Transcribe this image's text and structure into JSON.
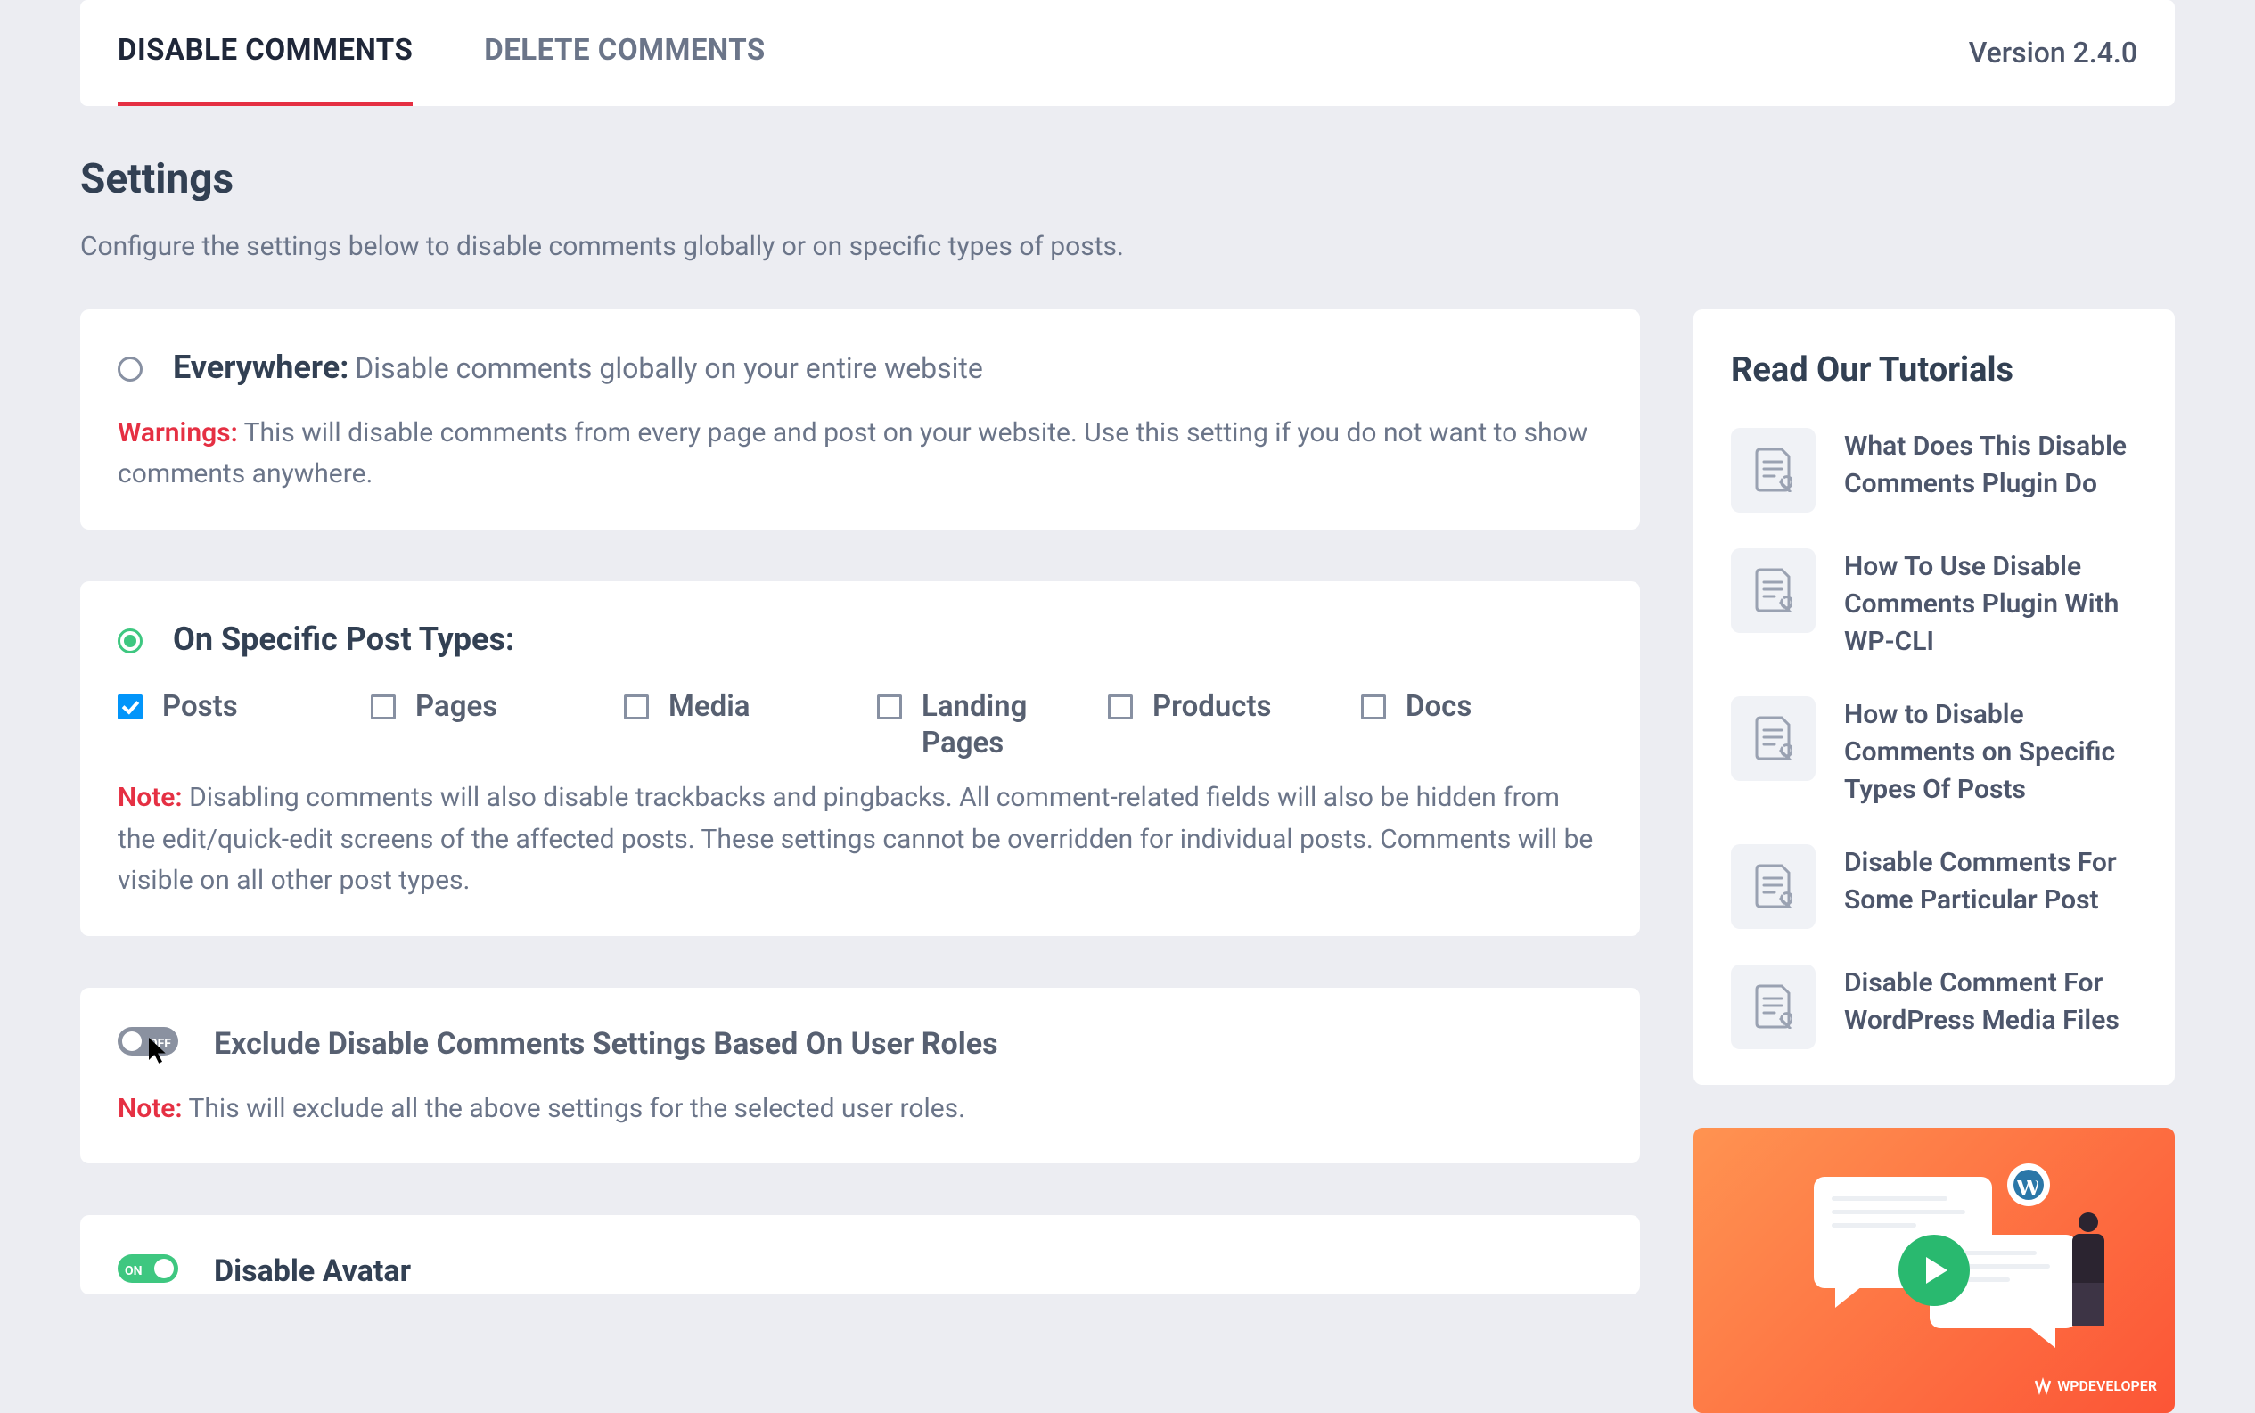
{
  "tabs": {
    "disable": "DISABLE COMMENTS",
    "delete": "DELETE COMMENTS"
  },
  "version": "Version 2.4.0",
  "page": {
    "title": "Settings",
    "subtitle": "Configure the settings below to disable comments globally or on specific types of posts."
  },
  "everywhere": {
    "title": "Everywhere:",
    "desc": "Disable comments globally on your entire website",
    "warn_label": "Warnings:",
    "warn_text": "This will disable comments from every page and post on your website. Use this setting if you do not want to show comments anywhere."
  },
  "specific": {
    "title": "On Specific Post Types:",
    "types": [
      {
        "label": "Posts",
        "checked": true
      },
      {
        "label": "Pages",
        "checked": false
      },
      {
        "label": "Media",
        "checked": false
      },
      {
        "label": "Landing Pages",
        "checked": false
      },
      {
        "label": "Products",
        "checked": false
      },
      {
        "label": "Docs",
        "checked": false
      }
    ],
    "note_label": "Note:",
    "note_text": "Disabling comments will also disable trackbacks and pingbacks. All comment-related fields will also be hidden from the edit/quick-edit screens of the affected posts. These settings cannot be overridden for individual posts. Comments will be visible on all other post types."
  },
  "exclude": {
    "toggle_state": "OFF",
    "title": "Exclude Disable Comments Settings Based On User Roles",
    "note_label": "Note:",
    "note_text": "This will exclude all the above settings for the selected user roles."
  },
  "avatar": {
    "toggle_state": "ON",
    "title": "Disable Avatar"
  },
  "sidebar": {
    "title": "Read Our Tutorials",
    "items": [
      "What Does This Disable Comments Plugin Do",
      "How To Use Disable Comments Plugin With WP-CLI",
      "How to Disable Comments on Specific Types Of Posts",
      "Disable Comments For Some Particular Post",
      "Disable Comment For WordPress Media Files"
    ]
  },
  "promo": {
    "brand": "WPDEVELOPER"
  }
}
